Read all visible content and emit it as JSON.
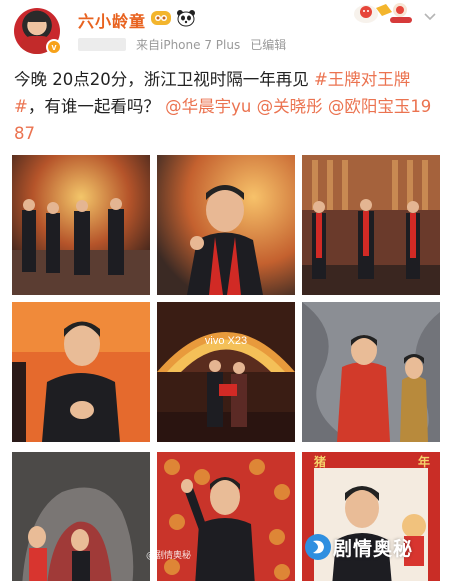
{
  "user": {
    "name": "六小龄童",
    "verified_badge": "v",
    "device": "来自iPhone 7 Plus",
    "edited": "已编辑"
  },
  "post": {
    "segments": [
      {
        "text": "今晚  20点20分，浙江卫视时隔一年再见 ",
        "tag": false
      },
      {
        "text": "#王牌对王牌#",
        "tag": true
      },
      {
        "text": "，有谁一起看吗？ ",
        "tag": false
      },
      {
        "text": "@华晨宇yu",
        "tag": true
      },
      {
        "text": " ",
        "tag": false
      },
      {
        "text": "@关晓彤",
        "tag": true
      },
      {
        "text": " ",
        "tag": false
      },
      {
        "text": "@欧阳宝玉1987",
        "tag": true
      }
    ]
  },
  "images": [
    {
      "name": "photo-1-group-on-stage"
    },
    {
      "name": "photo-2-closeup-red-scarf"
    },
    {
      "name": "photo-3-stage-lineup"
    },
    {
      "name": "photo-4-clapping"
    },
    {
      "name": "photo-5-vivo-stage",
      "text": "vivo X23"
    },
    {
      "name": "photo-6-red-jacket-duo"
    },
    {
      "name": "photo-7-cave-scene"
    },
    {
      "name": "photo-8-waving"
    },
    {
      "name": "photo-9-new-year-frame",
      "text_left": "猪",
      "text_right": "年"
    }
  ],
  "watermark": {
    "text": "剧情奥秘",
    "sub": "@剧情奥秘"
  },
  "colors": {
    "username": "#e8621f",
    "tag": "#eb7350",
    "meta": "#9a9a9a"
  }
}
